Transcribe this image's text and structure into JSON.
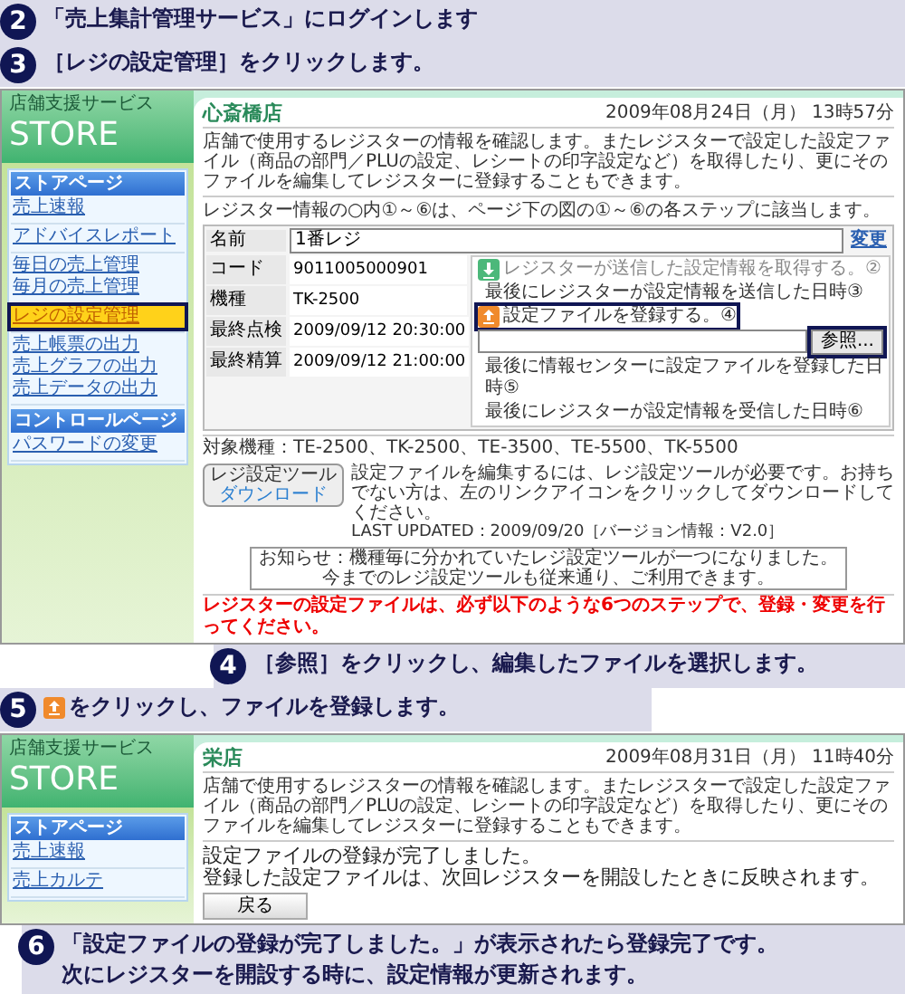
{
  "step_2": {
    "number": "2",
    "lines": [
      "「売上集計管理サービス」にログインします"
    ]
  },
  "step_3": {
    "number": "3",
    "lines": [
      "［レジの設定管理］をクリックします。"
    ]
  },
  "screenshot_1": {
    "logo": {
      "title": "店舗支援サービス",
      "brand": "STORE"
    },
    "sidebar": [
      {
        "title": "ストアページ",
        "groups": [
          [
            {
              "label": "売上速報",
              "selected": false
            }
          ],
          [
            {
              "label": "アドバイスレポート",
              "selected": false
            }
          ],
          [
            {
              "label": "毎日の売上管理",
              "selected": false
            },
            {
              "label": "毎月の売上管理",
              "selected": false
            }
          ],
          [
            {
              "label": "レジの設定管理",
              "selected": true
            }
          ],
          [
            {
              "label": "売上帳票の出力",
              "selected": false
            },
            {
              "label": "売上グラフの出力",
              "selected": false
            },
            {
              "label": "売上データの出力",
              "selected": false
            }
          ]
        ]
      },
      {
        "title": "コントロールページ",
        "groups": [
          [
            {
              "label": "パスワードの変更",
              "selected": false
            }
          ]
        ]
      }
    ],
    "store_name": "心斎橋店",
    "datetime": "2009年08月24日（月） 13時57分",
    "description": "店舗で使用するレジスターの情報を確認します。またレジスターで設定した設定ファイル（商品の部門／PLUの設定、レシートの印字設定など）を取得したり、更にそのファイルを編集してレジスターに登録することもできます。",
    "info_note": "レジスター情報の○内①～⑥は、ページ下の図の①～⑥の各ステップに該当します。",
    "name_row": {
      "label": "名前",
      "value": "1番レジ",
      "link": "変更"
    },
    "rows": [
      {
        "label": "コード",
        "value": "9011005000901"
      },
      {
        "label": "機種",
        "value": "TK-2500"
      },
      {
        "label": "最終点検",
        "value": "2009/09/12 20:30:00"
      },
      {
        "label": "最終精算",
        "value": "2009/09/12 21:00:00"
      }
    ],
    "panel": [
      {
        "kind": "fetch_action",
        "text": "レジスターが送信した設定情報を取得する。②",
        "highlighted": false
      },
      {
        "kind": "info",
        "text": "最後にレジスターが設定情報を送信した日時③"
      },
      {
        "kind": "register_action",
        "text": "設定ファイルを登録する。④",
        "highlighted": true
      },
      {
        "kind": "file",
        "button": "参照...",
        "highlighted": true
      },
      {
        "kind": "info",
        "text": "最後に情報センターに設定ファイルを登録した日時⑤"
      },
      {
        "kind": "info",
        "text": "最後にレジスターが設定情報を受信した日時⑥"
      }
    ],
    "supported_models": "対象機種：TE-2500、TK-2500、TE-3500、TE-5500、TK-5500",
    "download_button": [
      "レジ設定ツール",
      "ダウンロード"
    ],
    "download_note": "設定ファイルを編集するには、レジ設定ツールが必要です。お持ちでない方は、左のリンクアイコンをクリックしてダウンロードしてください。",
    "last_updated": "LAST UPDATED：2009/09/20［バージョン情報：V2.0］",
    "notice": [
      "お知らせ：機種毎に分かれていたレジ設定ツールが一つになりました。",
      "今までのレジ設定ツールも従来通り、ご利用できます。"
    ],
    "warning": "レジスターの設定ファイルは、必ず以下のような6つのステップで、登録・変更を行ってください。"
  },
  "step_4": {
    "number": "4",
    "lines": [
      "［参照］をクリックし、編集したファイルを選択します。"
    ]
  },
  "step_5": {
    "number": "5",
    "kind": "with_upload_icon",
    "lines": [
      "をクリックし、ファイルを登録します。"
    ]
  },
  "screenshot_2": {
    "logo": {
      "title": "店舗支援サービス",
      "brand": "STORE"
    },
    "sidebar": [
      {
        "title": "ストアページ",
        "groups": [
          [
            {
              "label": "売上速報",
              "selected": false
            }
          ],
          [
            {
              "label": "売上カルテ",
              "selected": false
            }
          ]
        ]
      }
    ],
    "store_name": "栄店",
    "datetime": "2009年08月31日（月） 11時40分",
    "description": "店舗で使用するレジスターの情報を確認します。またレジスターで設定した設定ファイル（商品の部門／PLUの設定、レシートの印字設定など）を取得したり、更にそのファイルを編集してレジスターに登録することもできます。",
    "message": [
      "設定ファイルの登録が完了しました。",
      "登録した設定ファイルは、次回レジスターを開設したときに反映されます。"
    ],
    "back_button": "戻る"
  },
  "step_6": {
    "number": "6",
    "lines": [
      "「設定ファイルの登録が完了しました。」が表示されたら登録完了です。",
      "次にレジスターを開設する時に、設定情報が更新されます。"
    ]
  }
}
